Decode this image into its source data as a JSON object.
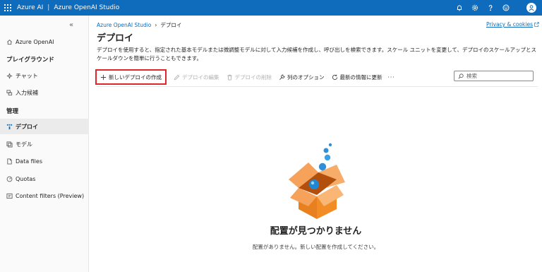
{
  "topbar": {
    "brand_primary": "Azure AI",
    "separator": "|",
    "brand_secondary": "Azure OpenAI Studio",
    "icons": [
      "bell-icon",
      "gear-icon",
      "help-icon",
      "feedback-icon",
      "user-avatar-icon"
    ],
    "bg_color": "#0f6cbd"
  },
  "sidebar": {
    "collapse_glyph": "«",
    "top_item": "Azure OpenAI",
    "section_playground": "プレイグラウンド",
    "playground_items": [
      "チャット",
      "入力候補"
    ],
    "section_manage": "管理",
    "manage_items": [
      "デプロイ",
      "モデル",
      "Data files",
      "Quotas",
      "Content filters (Preview)"
    ],
    "active_item": "デプロイ"
  },
  "main": {
    "breadcrumb_root": "Azure OpenAI Studio",
    "breadcrumb_current": "デプロイ",
    "privacy_link": "Privacy & cookies",
    "title": "デプロイ",
    "description": "デプロイを使用すると、指定された基本モデルまたは微調整モデルに対して入力候補を作成し、呼び出しを検索できます。スケール ユニットを変更して、デプロイのスケールアップとスケールダウンを簡単に行うこともできます。"
  },
  "toolbar": {
    "new_deployment": "新しいデプロイの作成",
    "edit": "デプロイの編集",
    "delete": "デプロイの削除",
    "column_options": "列のオプション",
    "refresh": "最新の情報に更新",
    "more": "···",
    "search_placeholder": "検索",
    "highlight_color": "#e0262b"
  },
  "empty_state": {
    "title": "配置が見つかりません",
    "subtitle": "配置がありません。新しい配置を作成してください。"
  }
}
